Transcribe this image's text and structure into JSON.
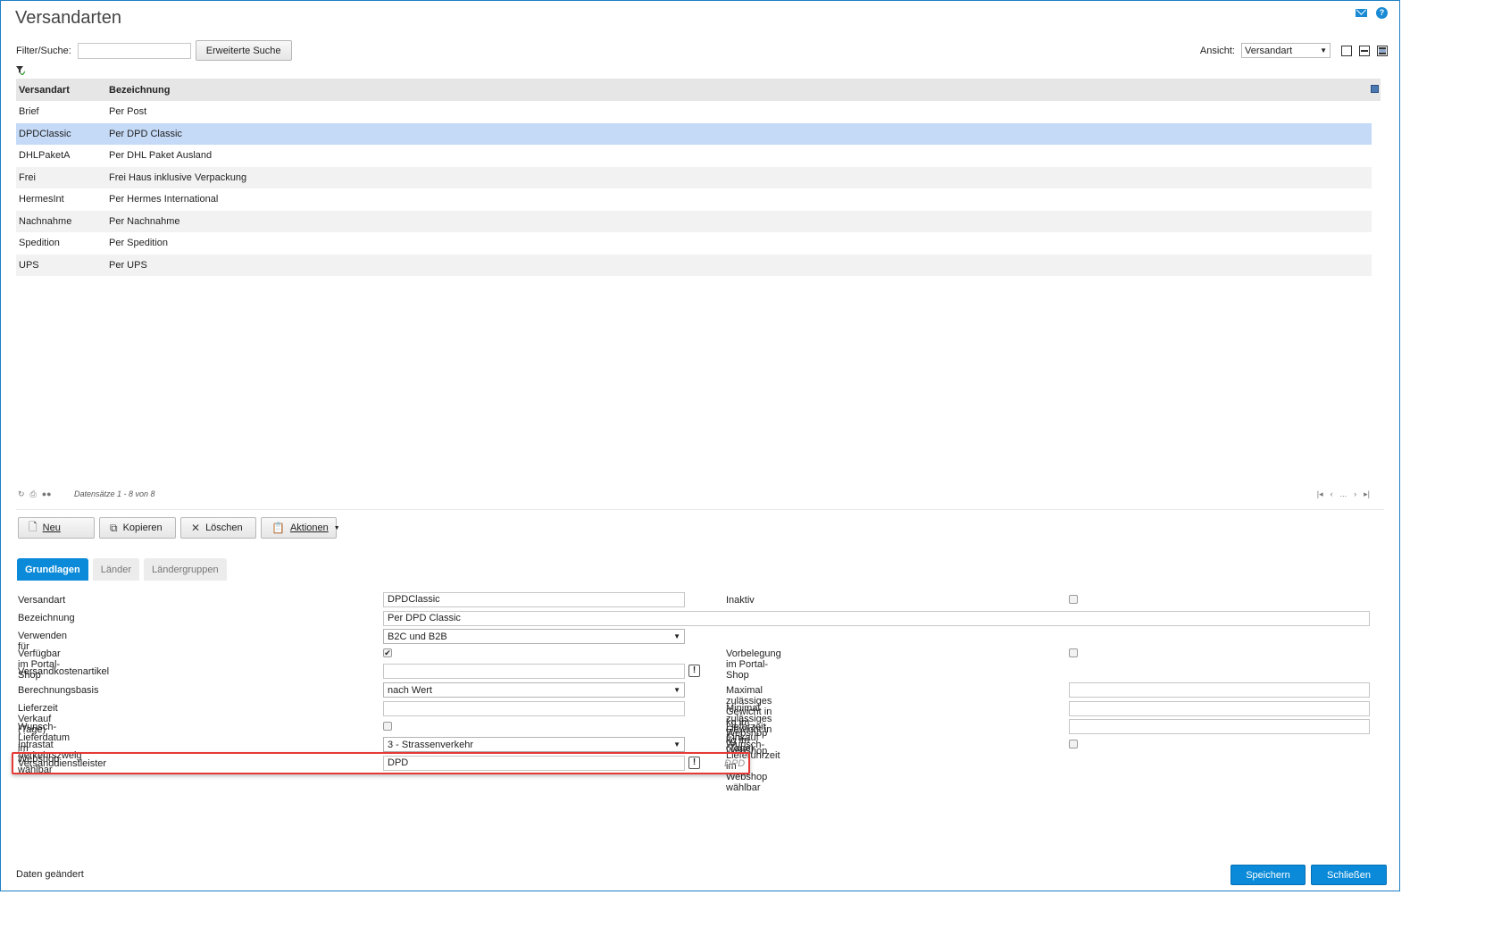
{
  "window": {
    "title": "Versandarten"
  },
  "filter": {
    "label": "Filter/Suche:",
    "value": "",
    "advanced_search": "Erweiterte Suche"
  },
  "view": {
    "label": "Ansicht:",
    "selected": "Versandart"
  },
  "grid": {
    "headers": [
      "Versandart",
      "Bezeichnung"
    ],
    "rows": [
      {
        "code": "Brief",
        "name": "Per Post"
      },
      {
        "code": "DPDClassic",
        "name": "Per DPD Classic"
      },
      {
        "code": "DHLPaketA",
        "name": "Per DHL Paket Ausland"
      },
      {
        "code": "Frei",
        "name": "Frei Haus inklusive Verpackung"
      },
      {
        "code": "HermesInt",
        "name": "Per Hermes International"
      },
      {
        "code": "Nachnahme",
        "name": "Per Nachnahme"
      },
      {
        "code": "Spedition",
        "name": "Per Spedition"
      },
      {
        "code": "UPS",
        "name": "Per UPS"
      }
    ],
    "selected_index": 1,
    "record_count": "Datensätze 1 - 8 von 8",
    "pager_ellipsis": "..."
  },
  "toolbar": {
    "new": "Neu",
    "copy": "Kopieren",
    "delete": "Löschen",
    "actions": "Aktionen"
  },
  "tabs": [
    "Grundlagen",
    "Länder",
    "Ländergruppen"
  ],
  "form": {
    "versandart": {
      "label": "Versandart",
      "value": "DPDClassic"
    },
    "inaktiv": {
      "label": "Inaktiv",
      "checked": false
    },
    "bezeichnung": {
      "label": "Bezeichnung",
      "value": "Per DPD Classic"
    },
    "verwenden": {
      "label": "Verwenden für",
      "value": "B2C und B2B"
    },
    "portal": {
      "label": "Verfügbar im Portal-Shop",
      "checked": true
    },
    "vorbelegung": {
      "label": "Vorbelegung im Portal-Shop",
      "checked": false
    },
    "kostenartikel": {
      "label": "Versandkostenartikel",
      "value": ""
    },
    "berechnungsbasis": {
      "label": "Berechnungsbasis",
      "value": "nach Wert"
    },
    "max_gewicht": {
      "label": "Maximal zulässiges Gewicht in kg im Webshop",
      "value": ""
    },
    "lieferzeit_verkauf": {
      "label": "Lieferzeit Verkauf (Tage)",
      "value": ""
    },
    "min_gewicht": {
      "label": "Minimal zulässiges Gewicht in kg im Webshop",
      "value": ""
    },
    "wunsch_datum": {
      "label": "Wunsch-Lieferdatum im Webshop wählbar",
      "checked": false
    },
    "lieferzeit_einkauf": {
      "label": "Lieferzeit Einkauf (Tage)",
      "value": ""
    },
    "intrastat": {
      "label": "Intrastat Verkehrszweig",
      "value": "3 - Strassenverkehr"
    },
    "wunsch_uhrzeit": {
      "label": "Wunsch-Lieferuhrzeit im Webshop wählbar",
      "checked": false
    },
    "dienstleister": {
      "label": "Versanddienstleister",
      "value": "DPD",
      "hint": "DPD"
    }
  },
  "status": {
    "text": "Daten geändert"
  },
  "footer": {
    "save": "Speichern",
    "close": "Schließen"
  },
  "colors": {
    "accent": "#0a8ad8",
    "selected_row": "#c5daf7",
    "highlight_border": "#e53935"
  }
}
